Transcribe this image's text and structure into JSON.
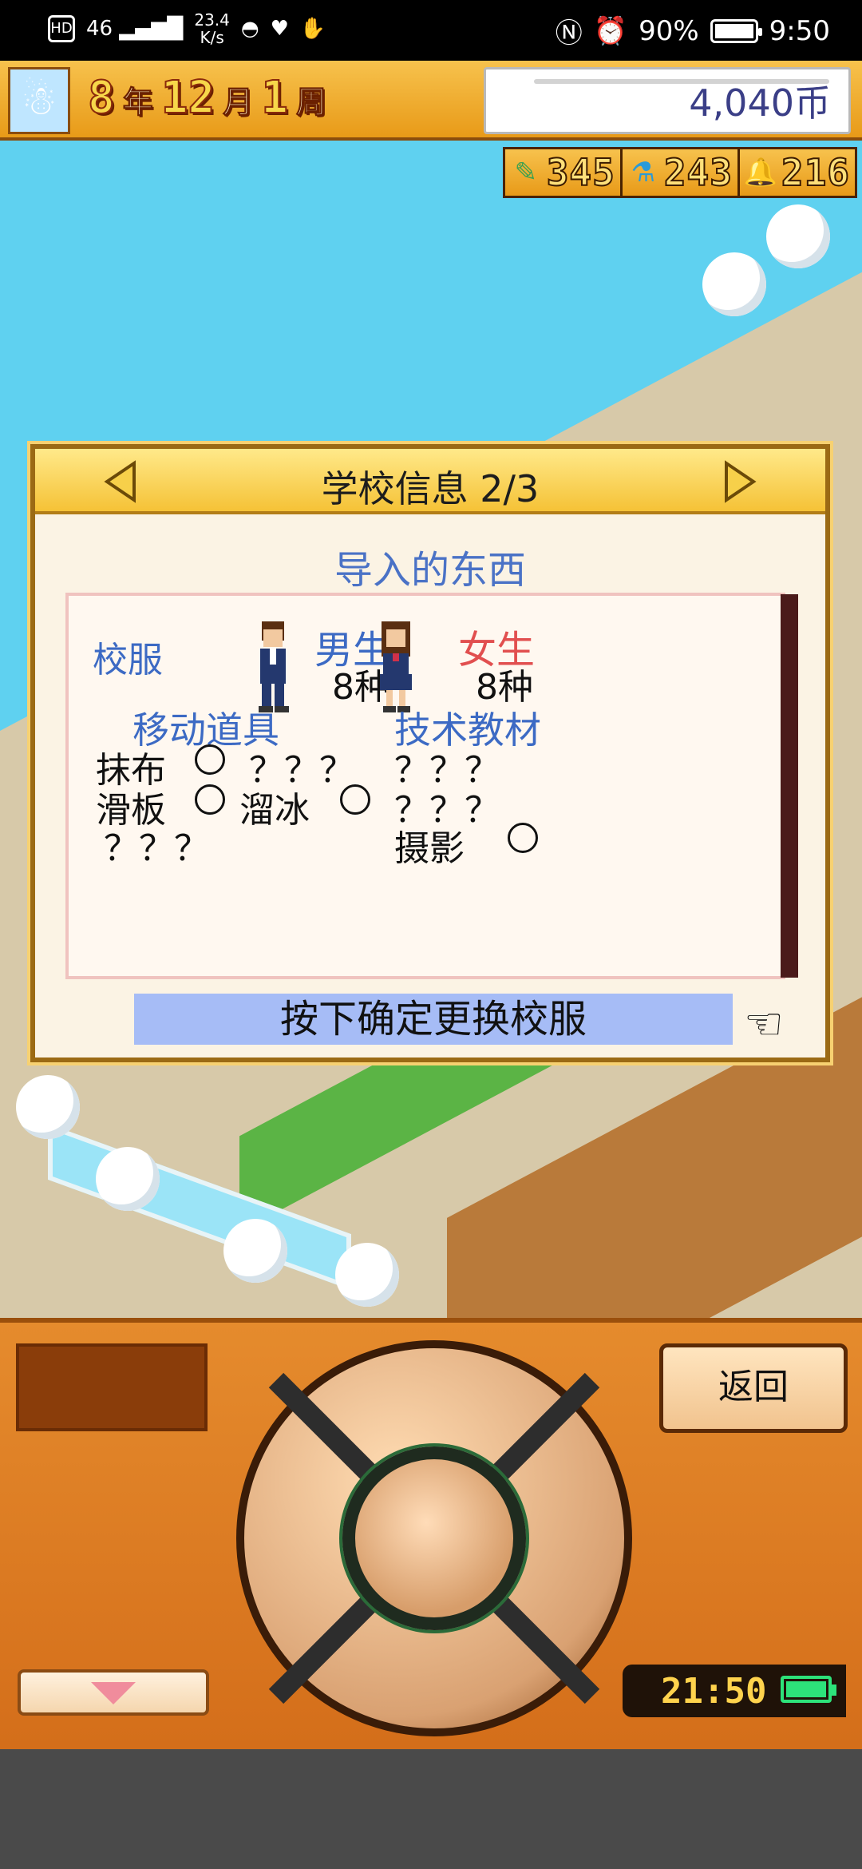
{
  "status_bar": {
    "network_left": "HD",
    "signal": "46",
    "speed_value": "23.4",
    "speed_unit": "K/s",
    "battery_percent": "90%",
    "time": "9:50"
  },
  "topbar": {
    "year_value": "8",
    "year_unit": "年",
    "month_value": "12",
    "month_unit": "月",
    "week_value": "1",
    "week_unit": "周",
    "money": "4,040币"
  },
  "resources": [
    {
      "icon": "pencil-icon",
      "value": "345"
    },
    {
      "icon": "flask-icon",
      "value": "243"
    },
    {
      "icon": "bell-icon",
      "value": "216"
    }
  ],
  "dialog": {
    "title": "学校信息 2/3",
    "subtitle": "导入的东西",
    "uniform_label": "校服",
    "male_label": "男生",
    "male_count": "8种",
    "female_label": "女生",
    "female_count": "8种",
    "items_header": "移动道具",
    "tech_header": "技术教材",
    "item_1": "抹布",
    "item_1_q": "？？？",
    "item_2": "滑板",
    "item_2b": "溜冰",
    "item_3_q": "？？？",
    "tech_1_q": "？？？",
    "tech_2_q": "？？？",
    "tech_3": "摄影",
    "confirm_text": "按下确定更换校服"
  },
  "controller": {
    "back_label": "返回",
    "clock": "21:50"
  },
  "colors": {
    "accent_blue": "#3c6ac4",
    "female_red": "#e14f4f",
    "confirm_bar": "#a6bcf6",
    "sky": "#5fd1f0"
  }
}
